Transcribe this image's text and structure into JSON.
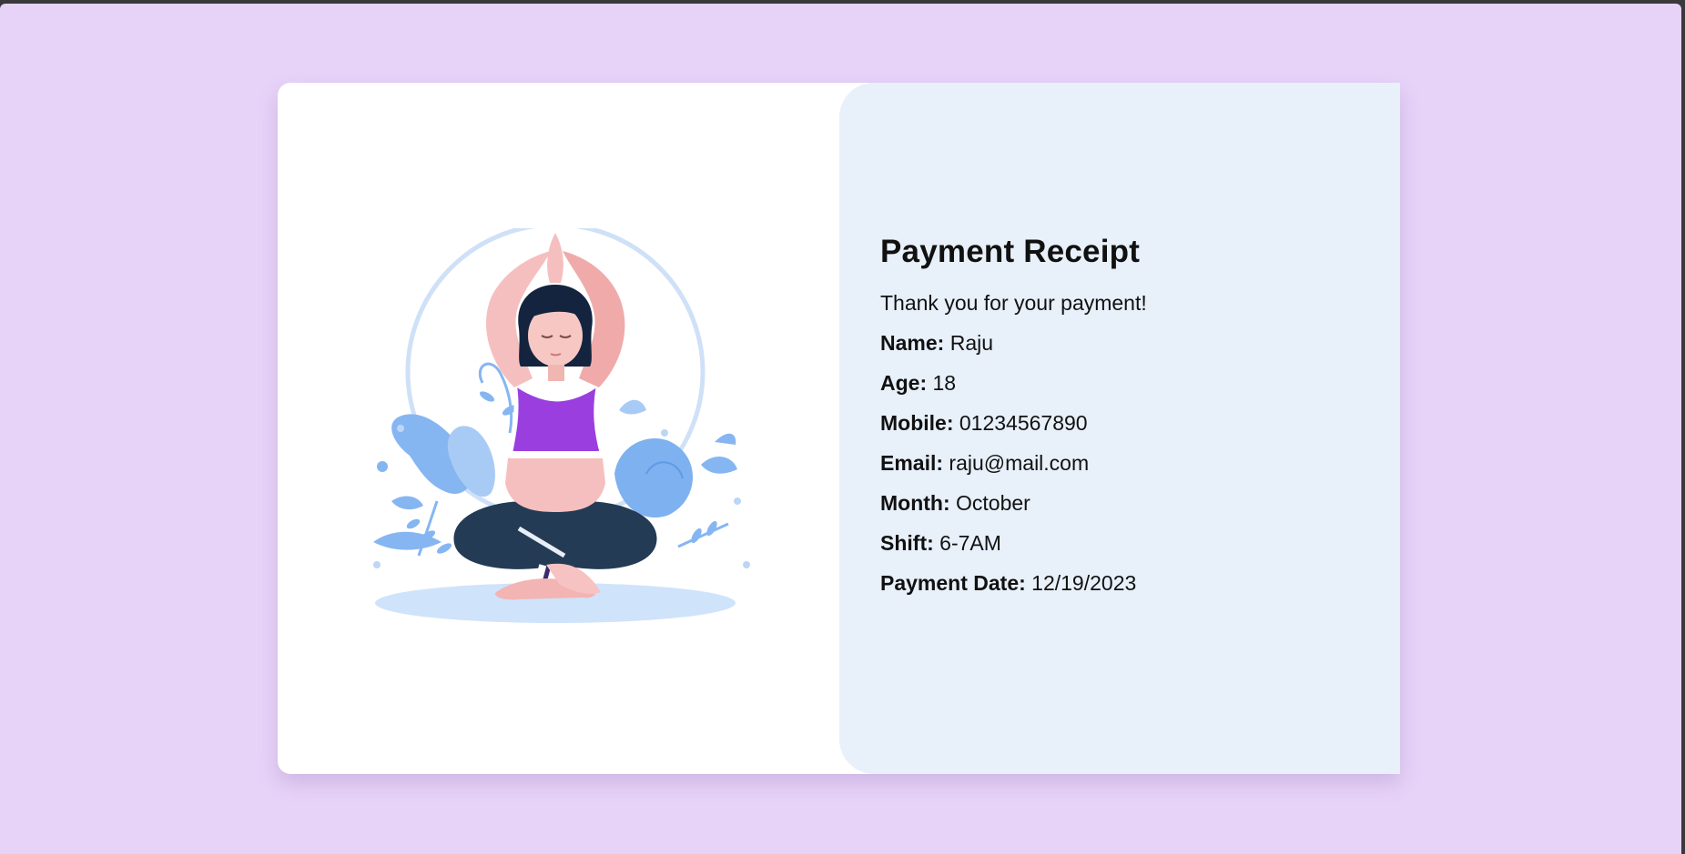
{
  "receipt": {
    "title": "Payment Receipt",
    "message": "Thank you for your payment!",
    "fields": [
      {
        "label": "Name:",
        "value": "Raju"
      },
      {
        "label": "Age:",
        "value": "18"
      },
      {
        "label": "Mobile:",
        "value": "01234567890"
      },
      {
        "label": "Email:",
        "value": "raju@mail.com"
      },
      {
        "label": "Month:",
        "value": "October"
      },
      {
        "label": "Shift:",
        "value": "6-7AM"
      },
      {
        "label": "Payment Date:",
        "value": "12/19/2023"
      }
    ]
  },
  "illustration": {
    "icon": "yoga-meditation-illustration",
    "colors": {
      "page_background": "#e7d3f8",
      "panel_background": "#e8f0fa",
      "top_color": "#9b3ee0",
      "pants_color": "#243b55",
      "leaf_color": "#86b6f2"
    }
  }
}
